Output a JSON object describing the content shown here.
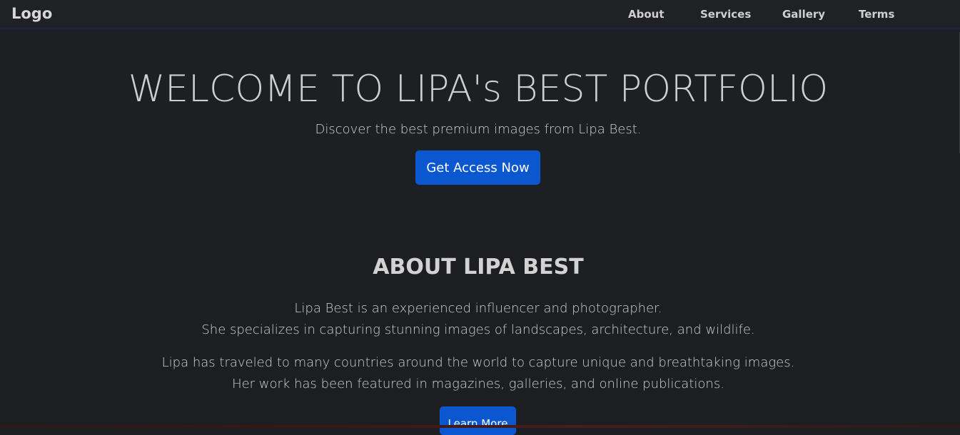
{
  "navbar": {
    "logo": "Logo",
    "links": [
      "About",
      "Services",
      "Gallery",
      "Terms"
    ]
  },
  "hero": {
    "title": "WELCOME TO LIPA's BEST PORTFOLIO",
    "subtitle": "Discover the best premium images from Lipa Best.",
    "button_label": "Get Access Now"
  },
  "about": {
    "title": "ABOUT LIPA BEST",
    "lines": [
      "Lipa Best is an experienced influencer and photographer.",
      "She specializes in capturing stunning images of landscapes, architecture, and wildlife.",
      "Lipa has traveled to many countries around the world to capture unique and breathtaking images.",
      "Her work has been featured in magazines, galleries, and online publications."
    ],
    "button_label": "Learn More"
  },
  "colors": {
    "background": "#1c1e21",
    "accent": "#0b57d0",
    "text": "#cfcfcf"
  }
}
